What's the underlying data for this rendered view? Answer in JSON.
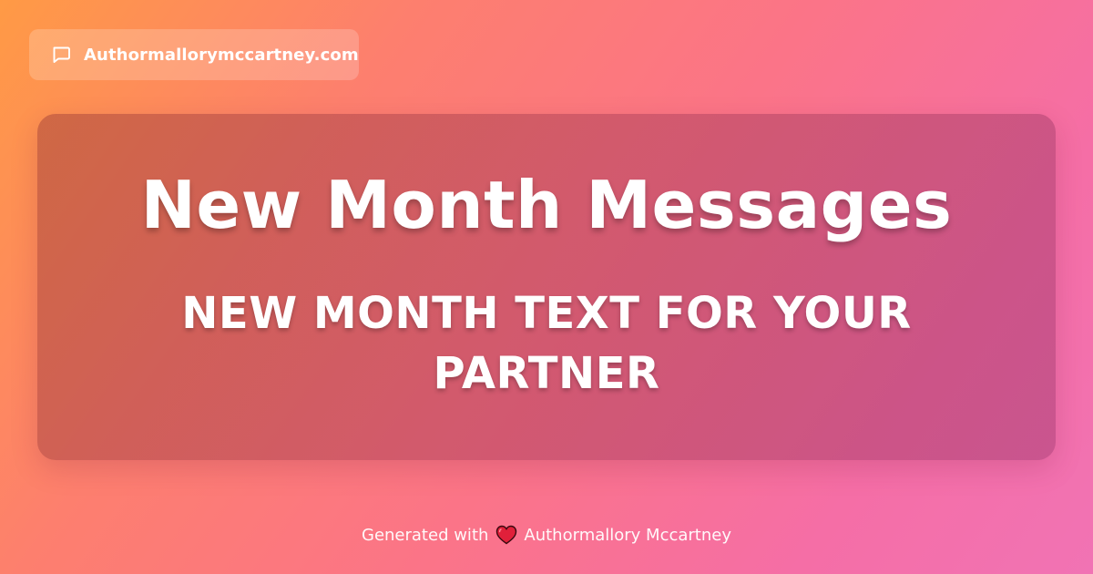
{
  "site": {
    "icon": "chat-bubble-icon",
    "domain": "Authormallorymccartney.com"
  },
  "card": {
    "title": "New Month Messages",
    "subtitle": "NEW MONTH TEXT FOR YOUR PARTNER"
  },
  "footer": {
    "prefix": "Generated with",
    "icon": "heart-icon",
    "author": "Authormallory Mccartney"
  },
  "colors": {
    "gradient_start": "#ff9a45",
    "gradient_end": "#f173b4",
    "heart": "#e0203a",
    "text": "#ffffff"
  }
}
